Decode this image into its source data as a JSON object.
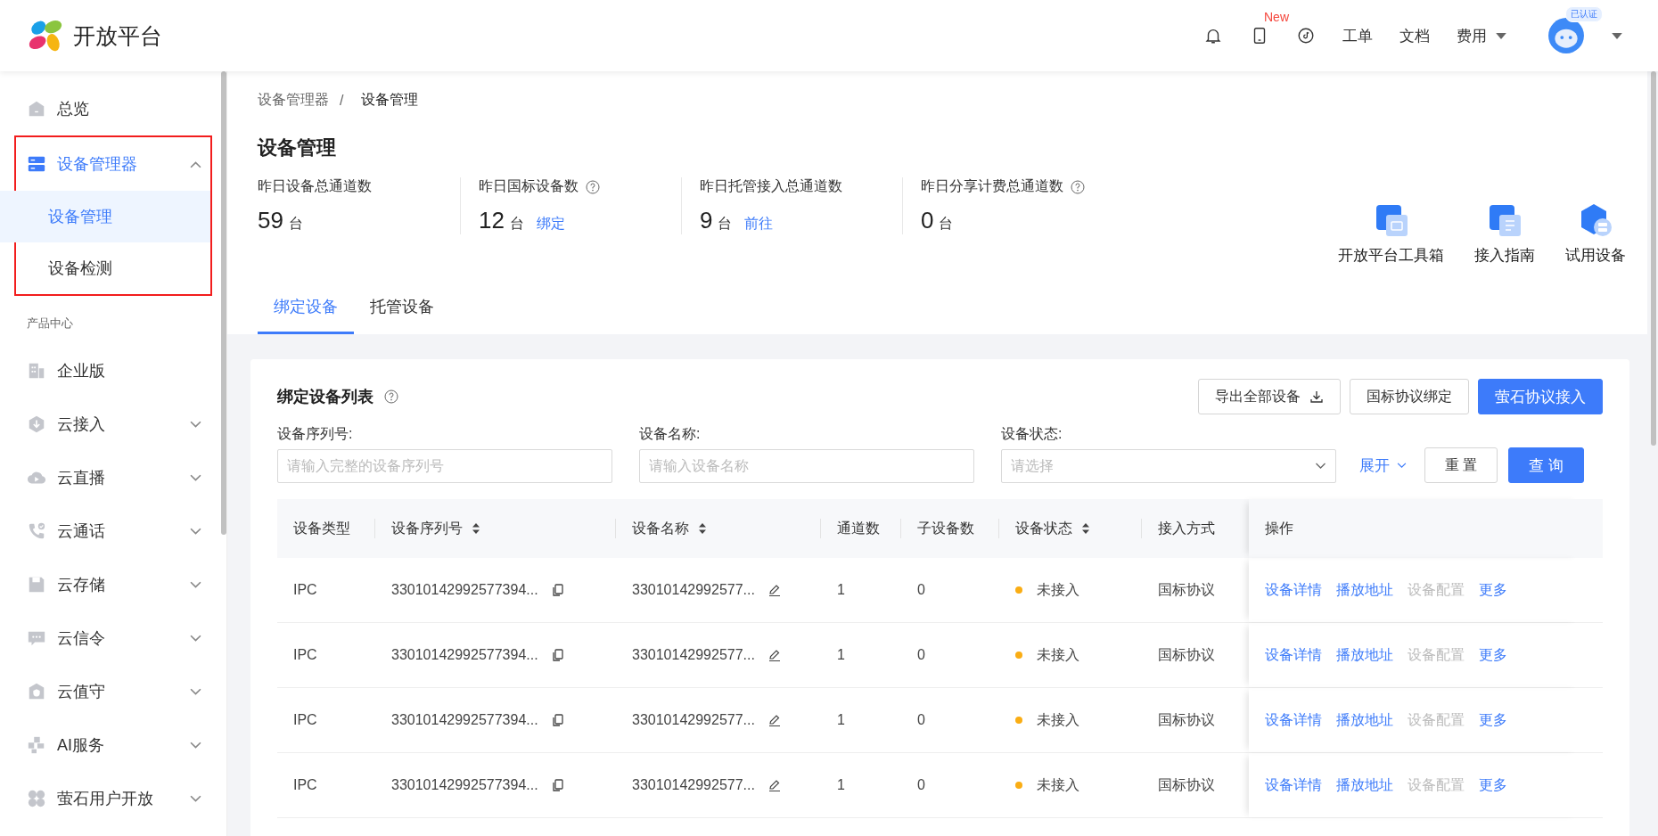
{
  "header": {
    "brand": "开放平台",
    "new_badge": "New",
    "links": [
      {
        "label": "工单",
        "dropdown": false
      },
      {
        "label": "文档",
        "dropdown": false
      },
      {
        "label": "费用",
        "dropdown": true
      }
    ],
    "avatar_badge": "已认证"
  },
  "sidebar": {
    "items": [
      {
        "kind": "link",
        "label": "总览",
        "selected": false
      },
      {
        "kind": "group",
        "label": "设备管理器",
        "selected": true,
        "expanded": true,
        "highlighted": true,
        "children": [
          {
            "label": "设备管理",
            "selected": true
          },
          {
            "label": "设备检测",
            "selected": false
          }
        ]
      },
      {
        "kind": "section",
        "label": "产品中心"
      },
      {
        "kind": "link",
        "label": "企业版",
        "selected": false
      },
      {
        "kind": "group",
        "label": "云接入",
        "selected": false,
        "expanded": false,
        "highlighted": false
      },
      {
        "kind": "group",
        "label": "云直播",
        "selected": false,
        "expanded": false,
        "highlighted": false
      },
      {
        "kind": "group",
        "label": "云通话",
        "selected": false,
        "expanded": false,
        "highlighted": false
      },
      {
        "kind": "group",
        "label": "云存储",
        "selected": false,
        "expanded": false,
        "highlighted": false
      },
      {
        "kind": "group",
        "label": "云信令",
        "selected": false,
        "expanded": false,
        "highlighted": false
      },
      {
        "kind": "group",
        "label": "云值守",
        "selected": false,
        "expanded": false,
        "highlighted": false
      },
      {
        "kind": "group",
        "label": "AI服务",
        "selected": false,
        "expanded": false,
        "highlighted": false
      },
      {
        "kind": "group",
        "label": "萤石用户开放",
        "selected": false,
        "expanded": false,
        "highlighted": false
      }
    ]
  },
  "breadcrumb": {
    "items": [
      "设备管理器",
      "设备管理"
    ],
    "separator": "/"
  },
  "page_title": "设备管理",
  "stats": [
    {
      "label": "昨日设备总通道数",
      "value": "59",
      "unit": "台",
      "help": false
    },
    {
      "label": "昨日国标设备数",
      "value": "12",
      "unit": "台",
      "link": "绑定",
      "help": true
    },
    {
      "label": "昨日托管接入总通道数",
      "value": "9",
      "unit": "台",
      "link": "前往",
      "help": false
    },
    {
      "label": "昨日分享计费总通道数",
      "value": "0",
      "unit": "台",
      "help": true
    }
  ],
  "quick_links": [
    "开放平台工具箱",
    "接入指南",
    "试用设备"
  ],
  "tabs": [
    {
      "label": "绑定设备",
      "selected": true
    },
    {
      "label": "托管设备",
      "selected": false
    }
  ],
  "card": {
    "title": "绑定设备列表",
    "buttons": [
      {
        "label": "导出全部设备",
        "kind": "download"
      },
      {
        "label": "国标协议绑定",
        "kind": "default"
      },
      {
        "label": "萤石协议接入",
        "kind": "primary"
      }
    ],
    "filters": [
      {
        "label": "设备序列号:",
        "placeholder": "请输入完整的设备序列号",
        "kind": "input"
      },
      {
        "label": "设备名称:",
        "placeholder": "请输入设备名称",
        "kind": "input"
      },
      {
        "label": "设备状态:",
        "placeholder": "请选择",
        "kind": "select"
      }
    ],
    "expand_link": "展开",
    "filter_buttons": [
      {
        "label": "重 置",
        "kind": "default"
      },
      {
        "label": "查 询",
        "kind": "primary"
      }
    ]
  },
  "table": {
    "columns": [
      {
        "label": "设备类型",
        "sortable": false
      },
      {
        "label": "设备序列号",
        "sortable": true
      },
      {
        "label": "设备名称",
        "sortable": true
      },
      {
        "label": "通道数",
        "sortable": false
      },
      {
        "label": "子设备数",
        "sortable": false
      },
      {
        "label": "设备状态",
        "sortable": true
      },
      {
        "label": "接入方式",
        "sortable": false
      },
      {
        "label": "操作",
        "sortable": false
      }
    ],
    "rows": [
      {
        "type": "IPC",
        "serial": "33010142992577394...",
        "name": "33010142992577...",
        "channels": "1",
        "sub_devices": "0",
        "status": "未接入",
        "color": "#faad14",
        "access": "国标协议",
        "actions": [
          {
            "label": "设备详情",
            "disabled": false
          },
          {
            "label": "播放地址",
            "disabled": false
          },
          {
            "label": "设备配置",
            "disabled": true
          },
          {
            "label": "更多",
            "disabled": false
          }
        ]
      },
      {
        "type": "IPC",
        "serial": "33010142992577394...",
        "name": "33010142992577...",
        "channels": "1",
        "sub_devices": "0",
        "status": "未接入",
        "color": "#faad14",
        "access": "国标协议",
        "actions": [
          {
            "label": "设备详情",
            "disabled": false
          },
          {
            "label": "播放地址",
            "disabled": false
          },
          {
            "label": "设备配置",
            "disabled": true
          },
          {
            "label": "更多",
            "disabled": false
          }
        ]
      },
      {
        "type": "IPC",
        "serial": "33010142992577394...",
        "name": "33010142992577...",
        "channels": "1",
        "sub_devices": "0",
        "status": "未接入",
        "color": "#faad14",
        "access": "国标协议",
        "actions": [
          {
            "label": "设备详情",
            "disabled": false
          },
          {
            "label": "播放地址",
            "disabled": false
          },
          {
            "label": "设备配置",
            "disabled": true
          },
          {
            "label": "更多",
            "disabled": false
          }
        ]
      },
      {
        "type": "IPC",
        "serial": "33010142992577394...",
        "name": "33010142992577...",
        "channels": "1",
        "sub_devices": "0",
        "status": "未接入",
        "color": "#faad14",
        "access": "国标协议",
        "actions": [
          {
            "label": "设备详情",
            "disabled": false
          },
          {
            "label": "播放地址",
            "disabled": false
          },
          {
            "label": "设备配置",
            "disabled": true
          },
          {
            "label": "更多",
            "disabled": false
          }
        ]
      }
    ]
  }
}
